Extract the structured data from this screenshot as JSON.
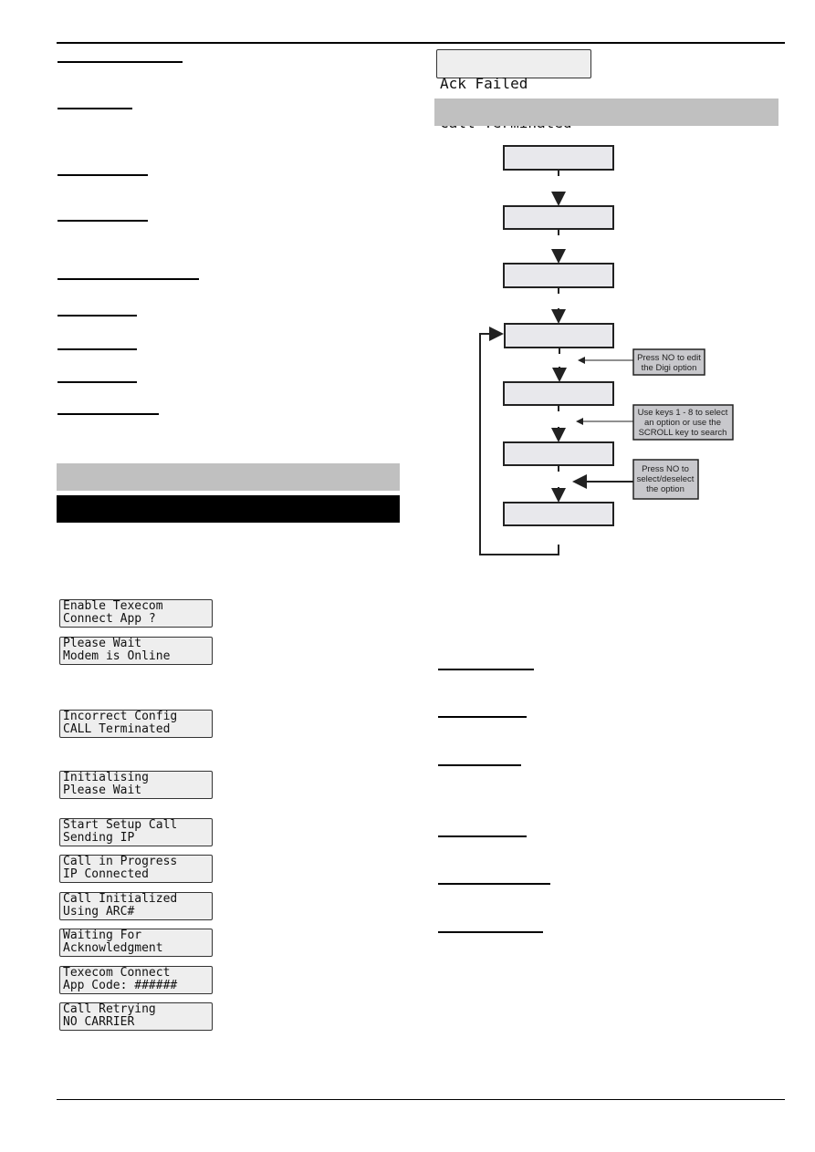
{
  "left_lcds": [
    {
      "line1": "Enable Texecom",
      "line2": "Connect App ?"
    },
    {
      "line1": "Please Wait",
      "line2": "Modem is Online"
    },
    {
      "line1": "Incorrect Config",
      "line2": "CALL Terminated"
    },
    {
      "line1": "Initialising",
      "line2": "Please Wait"
    },
    {
      "line1": "Start Setup Call",
      "line2": "Sending IP"
    },
    {
      "line1": "Call in Progress",
      "line2": "IP Connected"
    },
    {
      "line1": "Call Initialized",
      "line2": "Using ARC#"
    },
    {
      "line1": "Waiting For",
      "line2": "Acknowledgment"
    },
    {
      "line1": "Texecom Connect",
      "line2": "App Code: ######"
    },
    {
      "line1": "Call Retrying",
      "line2": "NO CARRIER"
    }
  ],
  "right_lcd": {
    "line1": "Ack Failed",
    "line2": "Call Terminated"
  },
  "flowchart": {
    "callouts": [
      {
        "line1": "Press NO to edit",
        "line2": "the Digi option"
      },
      {
        "line1": "Use keys 1 - 8 to select",
        "line2": "an option or use the",
        "line3": "SCROLL key to search"
      },
      {
        "line1": "Press NO to",
        "line2": "select/deselect",
        "line3": "the option"
      }
    ]
  },
  "colors": {
    "section_bar": "#c0c0c0",
    "header_bar": "#000000",
    "lcd_bg": "#eeeeee",
    "flow_box": "#e8e8ec",
    "callout": "#c8c8cc"
  }
}
